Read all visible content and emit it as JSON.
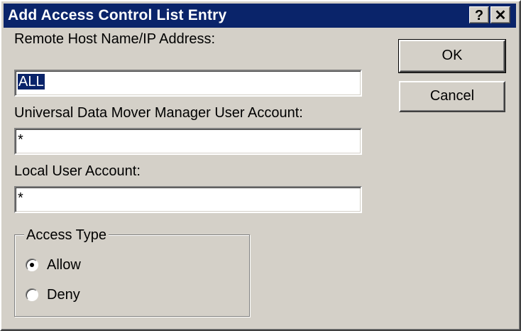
{
  "dialog": {
    "title": "Add Access Control List Entry",
    "help_glyph": "?",
    "close_glyph": "✕"
  },
  "fields": {
    "remote_host_label": "Remote Host Name/IP Address:",
    "remote_host_value": "ALL",
    "udm_user_label": "Universal Data Mover Manager User Account:",
    "udm_user_value": "*",
    "local_user_label": "Local User Account:",
    "local_user_value": "*"
  },
  "buttons": {
    "ok": "OK",
    "cancel": "Cancel"
  },
  "access_type": {
    "label": "Access Type",
    "options": [
      {
        "label": "Allow",
        "selected": true
      },
      {
        "label": "Deny",
        "selected": false
      }
    ]
  },
  "colors": {
    "titlebar": "#0a246a",
    "face": "#d4d0c8"
  }
}
